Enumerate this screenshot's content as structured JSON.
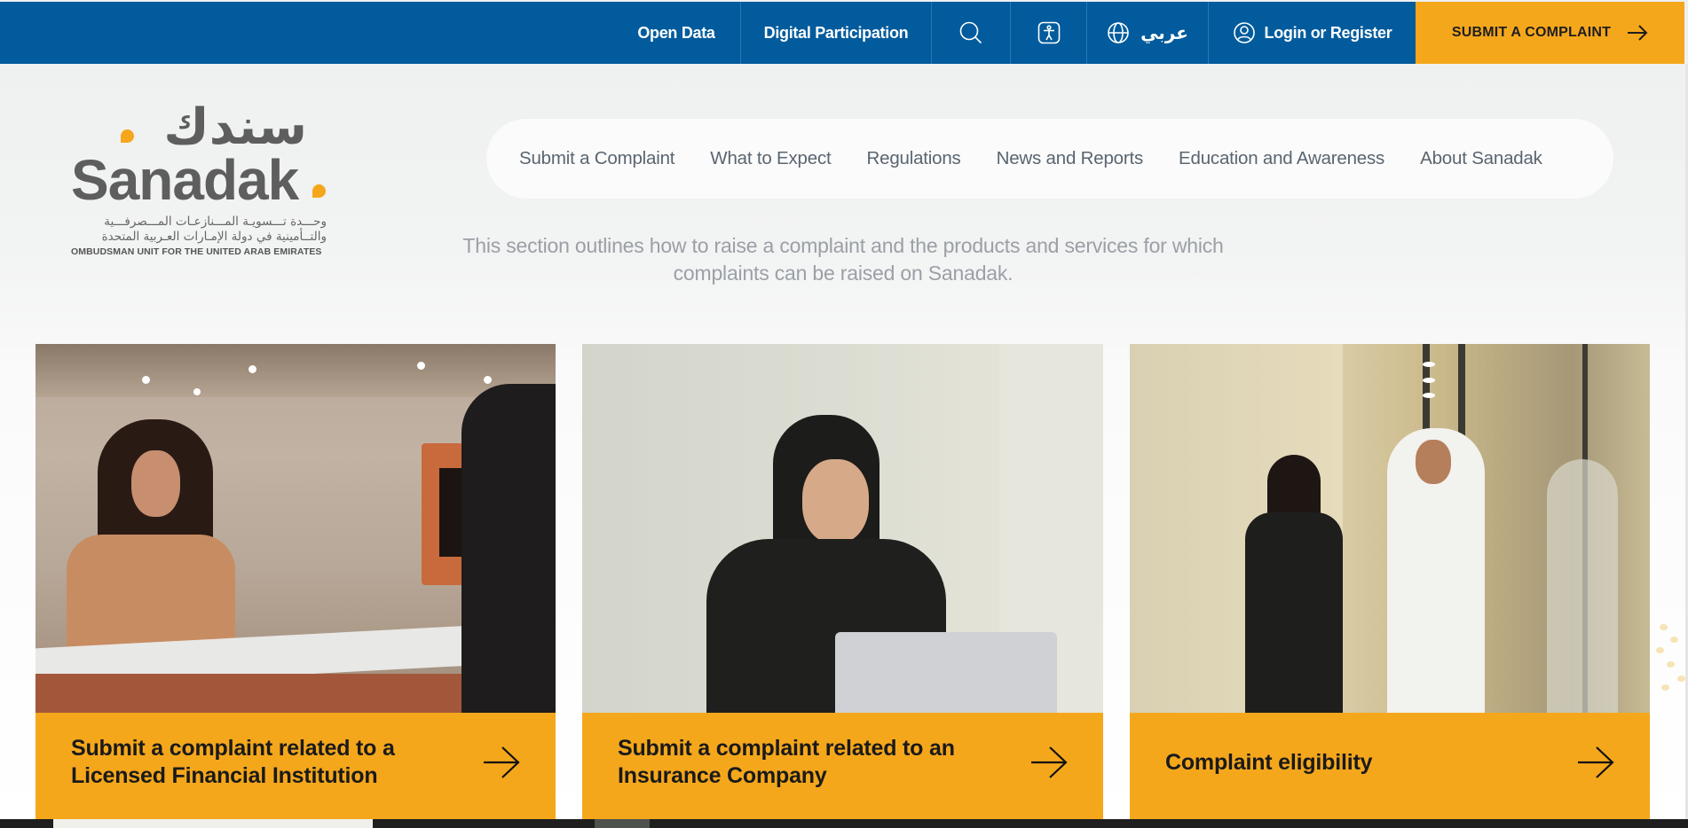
{
  "topbar": {
    "open_data": "Open Data",
    "digital_participation": "Digital Participation",
    "search_icon": "search-icon",
    "accessibility_icon": "accessibility-icon",
    "language_icon": "globe-icon",
    "language_label": "عربي",
    "user_icon": "user-circle-icon",
    "login_label": "Login or Register",
    "submit_label": "SUBMIT A COMPLAINT",
    "submit_icon": "arrow-right-icon"
  },
  "logo": {
    "arabic_name": "سندك",
    "english_name": "Sanadak",
    "arabic_line1": "وحـــدة تـــسويـة المـــنازعـات المـــصرفـــية",
    "arabic_line2": "والتــأمينية في دولة الإمـارات العـربية المتحدة",
    "english_tagline": "OMBUDSMAN UNIT FOR THE UNITED ARAB EMIRATES"
  },
  "nav": {
    "items": [
      {
        "label": "Submit a Complaint"
      },
      {
        "label": "What to Expect"
      },
      {
        "label": "Regulations"
      },
      {
        "label": "News and Reports"
      },
      {
        "label": "Education and Awareness"
      },
      {
        "label": "About Sanadak"
      }
    ]
  },
  "description": {
    "line1": "This section outlines how to raise a complaint and the products and services for which",
    "line2": "complaints can be raised on Sanadak."
  },
  "cards": [
    {
      "label_line1": "Submit a complaint related to a",
      "label_line2": "Licensed Financial Institution",
      "image": "woman at reception desk",
      "icon": "arrow-right-icon"
    },
    {
      "label_line1": "Submit a complaint related to an",
      "label_line2": "Insurance Company",
      "image": "woman in hijab with laptop",
      "icon": "arrow-right-icon"
    },
    {
      "label_line1": "Complaint eligibility",
      "label_line2": "",
      "image": "man and woman walking in corridor",
      "icon": "arrow-right-icon"
    }
  ],
  "colors": {
    "brand_blue": "#015b9c",
    "accent_orange": "#f5a71c",
    "logo_gray": "#5e5e5e",
    "nav_text": "#5a6570"
  }
}
